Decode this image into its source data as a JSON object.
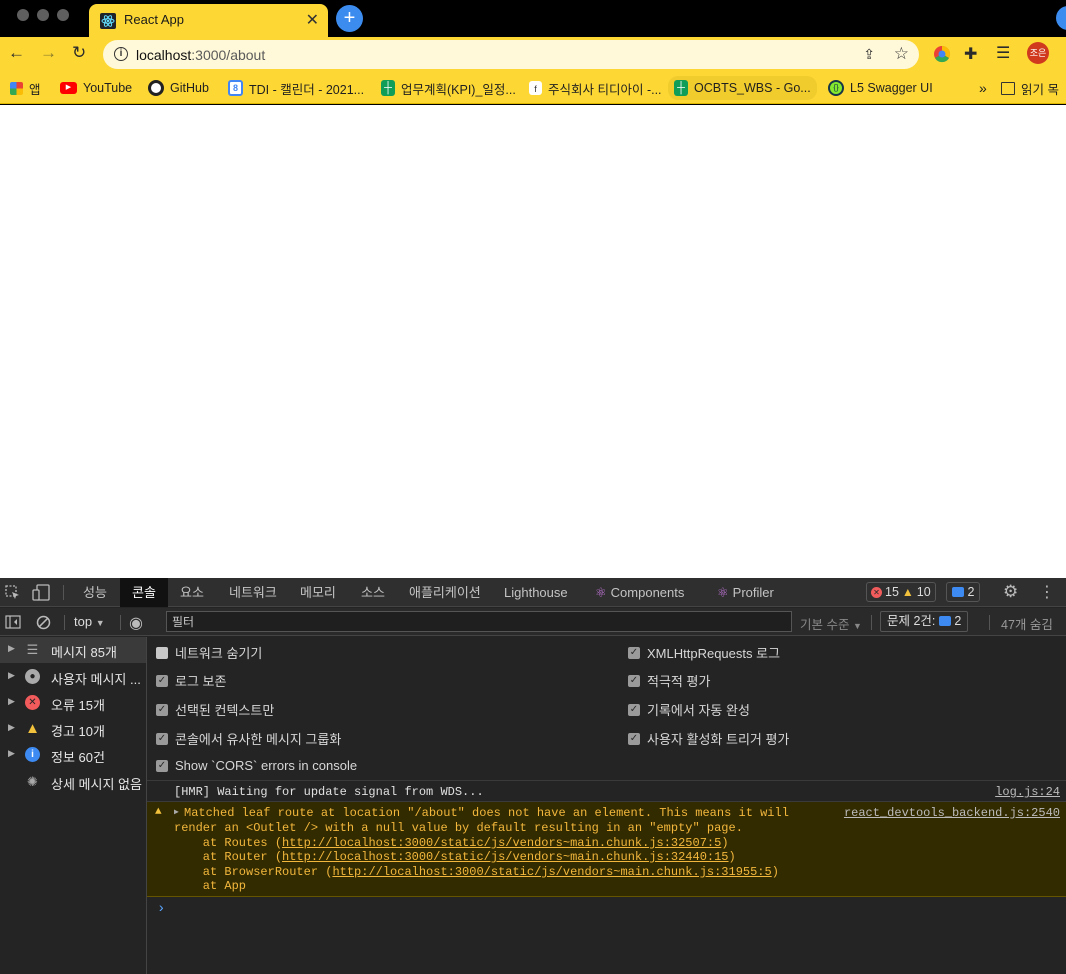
{
  "browser": {
    "tab_title": "React App",
    "tab_close": "✕",
    "new_tab": "+",
    "url_host": "localhost",
    "url_rest": ":3000/about",
    "profile_initials": "조은"
  },
  "bookmarks": [
    {
      "label": "앱",
      "color": "#e94235"
    },
    {
      "label": "YouTube",
      "color": "#ff0000"
    },
    {
      "label": "GitHub",
      "color": "#333333"
    },
    {
      "label": "TDI - 캘린더 - 2021...",
      "color": "#4285f4"
    },
    {
      "label": "업무계획(KPI)_일정...",
      "color": "#0f9d58"
    },
    {
      "label": "주식회사 티디아이 -...",
      "color": "#ffffff"
    },
    {
      "label": "OCBTS_WBS - Go...",
      "color": "#0f9d58"
    },
    {
      "label": "L5 Swagger UI",
      "color": "#85ea2d"
    },
    {
      "label": "»",
      "color": ""
    },
    {
      "label": "읽기 목",
      "color": ""
    }
  ],
  "devtools": {
    "tabs": [
      "성능",
      "콘솔",
      "요소",
      "네트워크",
      "메모리",
      "소스",
      "애플리케이션",
      "Lighthouse",
      "Components",
      "Profiler"
    ],
    "error_count": "15",
    "warning_count": "10",
    "issue_count": "2",
    "context": "top",
    "filter_placeholder": "필터",
    "level": "기본 수준",
    "issues_label": "문제 2건:",
    "issues_num": "2",
    "hidden": "47개 숨김",
    "sidebar": [
      {
        "label": "메시지 85개",
        "icon": "list-icon"
      },
      {
        "label": "사용자 메시지 ...",
        "icon": "user-icon"
      },
      {
        "label": "오류 15개",
        "icon": "error-icon"
      },
      {
        "label": "경고 10개",
        "icon": "warning-icon"
      },
      {
        "label": "정보 60건",
        "icon": "info-icon"
      },
      {
        "label": "상세 메시지 없음",
        "icon": "bug-icon"
      }
    ],
    "settings_left": [
      {
        "label": "네트워크 숨기기",
        "checked": false
      },
      {
        "label": "로그 보존",
        "checked": true
      },
      {
        "label": "선택된 컨텍스트만",
        "checked": true
      },
      {
        "label": "콘솔에서 유사한 메시지 그룹화",
        "checked": true
      },
      {
        "label": "Show `CORS` errors in console",
        "checked": true
      }
    ],
    "settings_right": [
      {
        "label": "XMLHttpRequests 로그",
        "checked": true
      },
      {
        "label": "적극적 평가",
        "checked": true
      },
      {
        "label": "기록에서 자동 완성",
        "checked": true
      },
      {
        "label": "사용자 활성화 트리거 평가",
        "checked": true
      }
    ],
    "log_hmr": "[HMR] Waiting for update signal from WDS...",
    "log_hmr_src": "log.js:24",
    "warn_src": "react_devtools_backend.js:2540",
    "warn_line1": "Matched leaf route at location \"/about\" does not have an element. This means it will",
    "warn_line2": "render an <Outlet /> with a null value by default resulting in an \"empty\" page.",
    "warn_routes_pre": "    at Routes (",
    "warn_routes_link": "http://localhost:3000/static/js/vendors~main.chunk.js:32507:5",
    "warn_router_pre": "    at Router (",
    "warn_router_link": "http://localhost:3000/static/js/vendors~main.chunk.js:32440:15",
    "warn_browser_pre": "    at BrowserRouter (",
    "warn_browser_link": "http://localhost:3000/static/js/vendors~main.chunk.js:31955:5",
    "warn_app": "    at App",
    "close_paren": ")",
    "prompt": "›"
  }
}
